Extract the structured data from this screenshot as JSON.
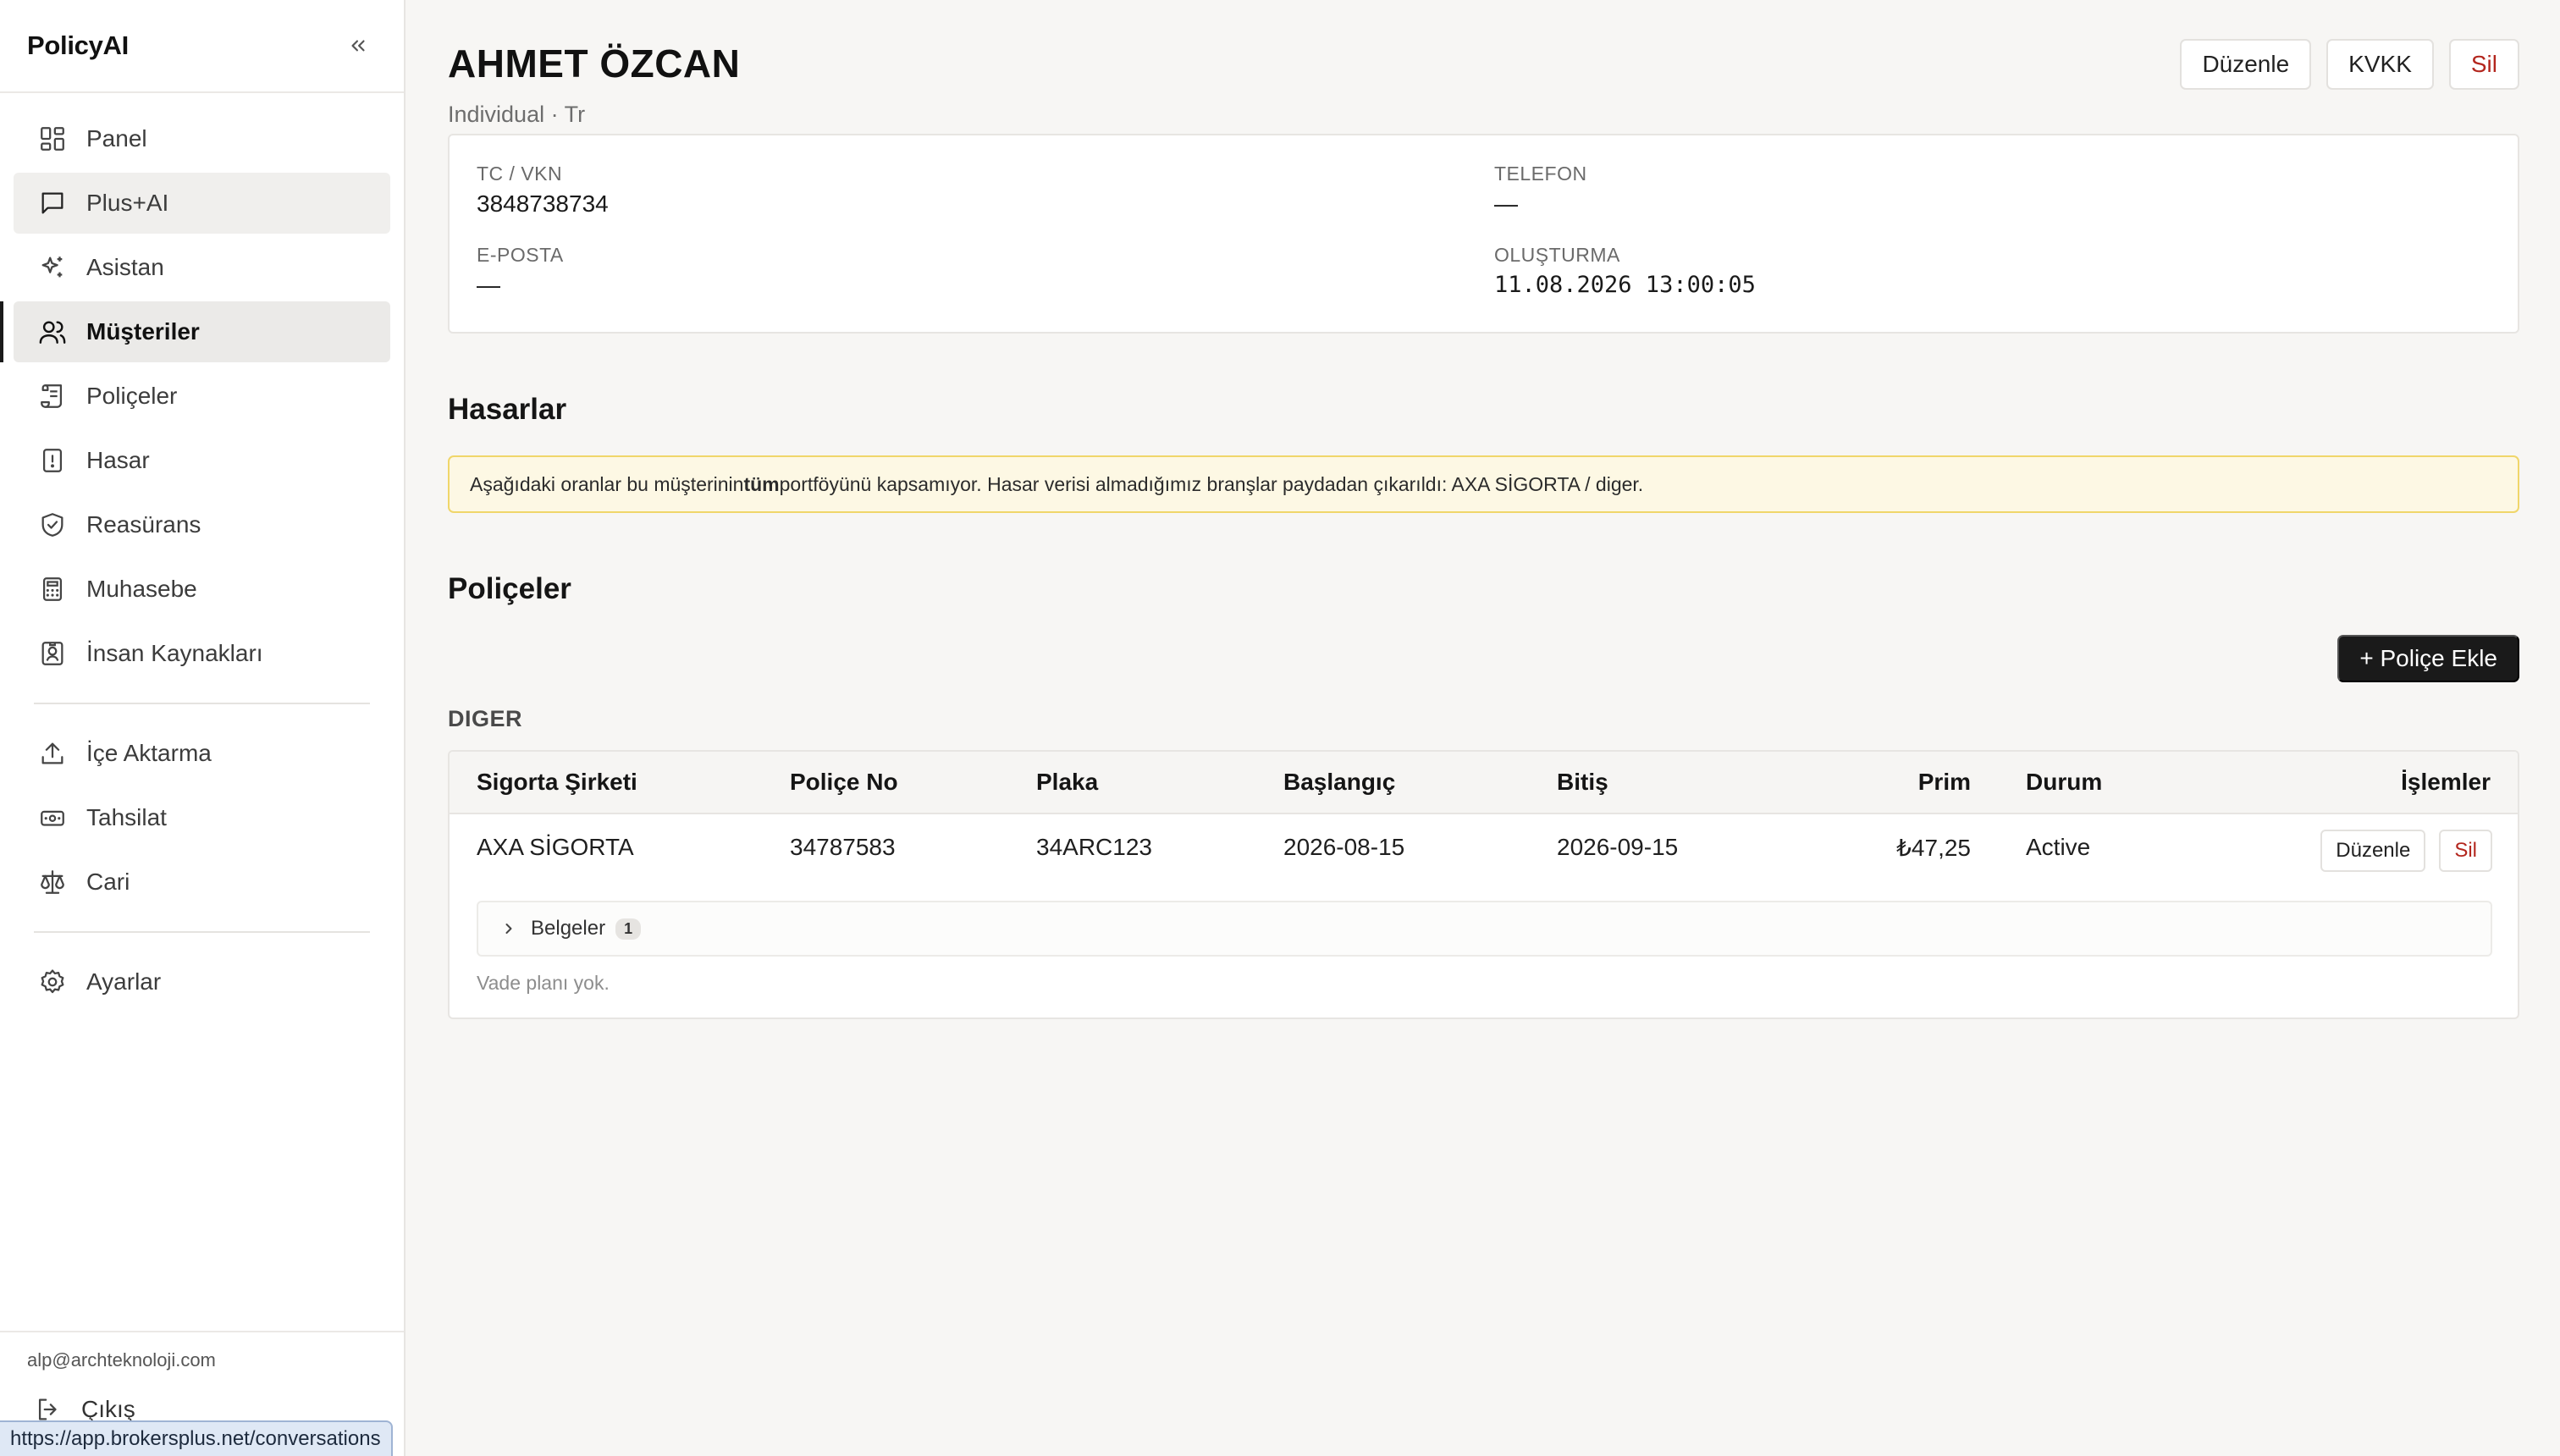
{
  "app": {
    "brand": "PolicyAI",
    "status_url": "https://app.brokersplus.net/conversations"
  },
  "sidebar": {
    "items": [
      {
        "label": "Panel",
        "icon": "dashboard-icon"
      },
      {
        "label": "Plus+AI",
        "icon": "chat-icon"
      },
      {
        "label": "Asistan",
        "icon": "sparkles-icon"
      },
      {
        "label": "Müşteriler",
        "icon": "users-icon"
      },
      {
        "label": "Poliçeler",
        "icon": "scroll-icon"
      },
      {
        "label": "Hasar",
        "icon": "alert-file-icon"
      },
      {
        "label": "Reasürans",
        "icon": "shield-check-icon"
      },
      {
        "label": "Muhasebe",
        "icon": "calculator-icon"
      },
      {
        "label": "İnsan Kaynakları",
        "icon": "id-badge-icon"
      },
      {
        "label": "İçe Aktarma",
        "icon": "upload-icon"
      },
      {
        "label": "Tahsilat",
        "icon": "banknote-icon"
      },
      {
        "label": "Cari",
        "icon": "scale-icon"
      },
      {
        "label": "Ayarlar",
        "icon": "gear-icon"
      }
    ],
    "active": "Müşteriler",
    "user_email": "alp@archteknoloji.com",
    "logout_label": "Çıkış"
  },
  "customer": {
    "name": "AHMET ÖZCAN",
    "subtitle": "Individual · Tr",
    "actions": {
      "edit": "Düzenle",
      "kvkk": "KVKK",
      "delete": "Sil"
    },
    "fields": {
      "tc_label": "TC / VKN",
      "tc_value": "3848738734",
      "phone_label": "TELEFON",
      "phone_value": "—",
      "email_label": "E-POSTA",
      "email_value": "—",
      "created_label": "OLUŞTURMA",
      "created_value": "11.08.2026 13:00:05"
    }
  },
  "claims": {
    "title": "Hasarlar",
    "warning_pre": "Aşağıdaki oranlar bu müşterinin ",
    "warning_bold": "tüm",
    "warning_post": " portföyünü kapsamıyor. Hasar verisi almadığımız branşlar paydadan çıkarıldı: AXA SİGORTA / diger."
  },
  "policies": {
    "title": "Poliçeler",
    "add_label": "+ Poliçe Ekle",
    "group": "DIGER",
    "columns": {
      "company": "Sigorta Şirketi",
      "policy_no": "Poliçe No",
      "plate": "Plaka",
      "start": "Başlangıç",
      "end": "Bitiş",
      "premium": "Prim",
      "status": "Durum",
      "actions": "İşlemler"
    },
    "rows": [
      {
        "company": "AXA SİGORTA",
        "policy_no": "34787583",
        "plate": "34ARC123",
        "start": "2026-08-15",
        "end": "2026-09-15",
        "premium": "₺47,25",
        "status": "Active",
        "edit": "Düzenle",
        "delete": "Sil"
      }
    ],
    "documents_label": "Belgeler",
    "documents_count": "1",
    "no_plan": "Vade planı yok."
  }
}
